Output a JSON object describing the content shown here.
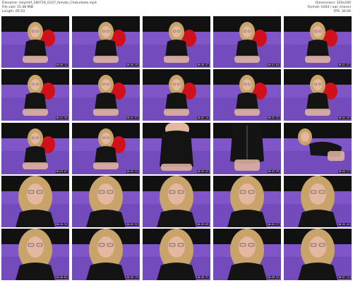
{
  "header": {
    "filename": "Filename: mkymilf_180716_0337_female_Chaturbate.mp4",
    "filesize": "File size: 15.48 MiB",
    "length": "Length: 05:53",
    "dimensions": "Dimensions: 320x240",
    "format": "Format: h264 / aac (mono)",
    "fps": "FPS: 30.00"
  },
  "thumbnails": [
    {
      "timestamp": "00:00:12",
      "variant": "sit"
    },
    {
      "timestamp": "00:00:29",
      "variant": "sit"
    },
    {
      "timestamp": "00:00:47",
      "variant": "sit"
    },
    {
      "timestamp": "00:01:04",
      "variant": "sit"
    },
    {
      "timestamp": "00:01:22",
      "variant": "sit"
    },
    {
      "timestamp": "00:01:39",
      "variant": "sit"
    },
    {
      "timestamp": "00:01:57",
      "variant": "sit"
    },
    {
      "timestamp": "00:02:14",
      "variant": "sit"
    },
    {
      "timestamp": "00:02:32",
      "variant": "sit"
    },
    {
      "timestamp": "00:02:49",
      "variant": "sit"
    },
    {
      "timestamp": "00:03:07",
      "variant": "sit"
    },
    {
      "timestamp": "00:03:24",
      "variant": "lean"
    },
    {
      "timestamp": "00:03:42",
      "variant": "stand"
    },
    {
      "timestamp": "00:03:59",
      "variant": "back"
    },
    {
      "timestamp": "00:04:17",
      "variant": "crawl"
    },
    {
      "timestamp": "00:04:34",
      "variant": "close"
    },
    {
      "timestamp": "00:04:52",
      "variant": "close"
    },
    {
      "timestamp": "00:05:09",
      "variant": "close"
    },
    {
      "timestamp": "00:05:27",
      "variant": "close"
    },
    {
      "timestamp": "00:05:44",
      "variant": "close"
    },
    {
      "timestamp": "00:06:02",
      "variant": "close"
    },
    {
      "timestamp": "00:06:19",
      "variant": "close"
    },
    {
      "timestamp": "00:06:37",
      "variant": "close"
    },
    {
      "timestamp": "00:06:54",
      "variant": "close"
    },
    {
      "timestamp": "00:07:12",
      "variant": "close"
    }
  ],
  "colors": {
    "couch": "#7f55c8",
    "couch_dark": "#5e3aa3",
    "wall": "#111111",
    "pillow": "#d0101a",
    "hair": "#c9a46a",
    "skin": "#e3b7a0",
    "dress": "#141414"
  }
}
